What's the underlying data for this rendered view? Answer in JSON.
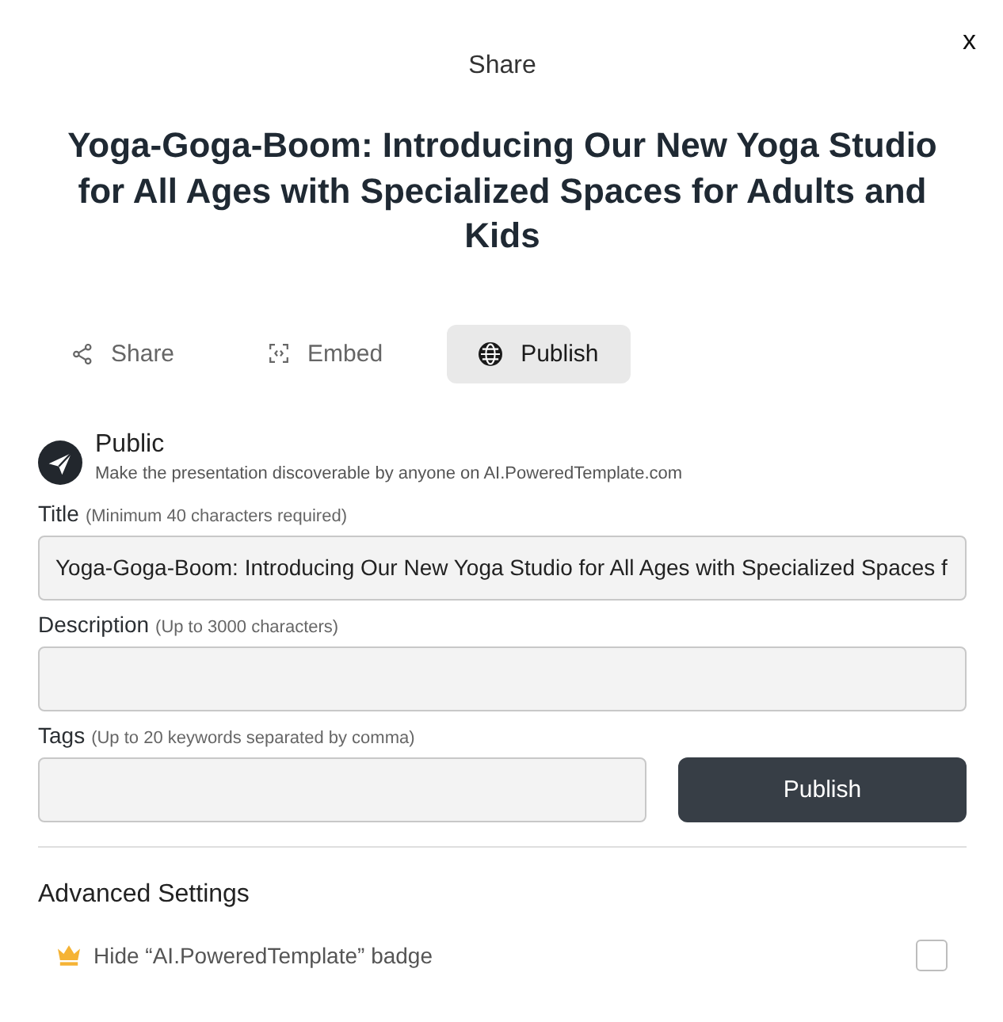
{
  "dialog": {
    "close_label": "x",
    "header": "Share",
    "title": "Yoga-Goga-Boom: Introducing Our New Yoga Studio for All Ages with Specialized Spaces for Adults and Kids"
  },
  "tabs": [
    {
      "kind": "share",
      "label": "Share",
      "selected": false
    },
    {
      "kind": "embed",
      "label": "Embed",
      "selected": false
    },
    {
      "kind": "publish",
      "label": "Publish",
      "selected": true
    }
  ],
  "visibility": {
    "title": "Public",
    "description": "Make the presentation discoverable by anyone on AI.PoweredTemplate.com"
  },
  "fields": [
    {
      "label": "Title",
      "hint": "(Minimum 40 characters required)",
      "value": "Yoga-Goga-Boom: Introducing Our New Yoga Studio for All Ages with Specialized Spaces f"
    },
    {
      "label": "Description",
      "hint": "(Up to 3000 characters)"
    },
    {
      "label": "Tags",
      "hint": "(Up to 20 keywords separated by comma)",
      "button": "Publish"
    }
  ],
  "advanced": {
    "heading": "Advanced Settings",
    "options": [
      {
        "label": "Hide “AI.PoweredTemplate” badge",
        "checked": false
      }
    ]
  }
}
